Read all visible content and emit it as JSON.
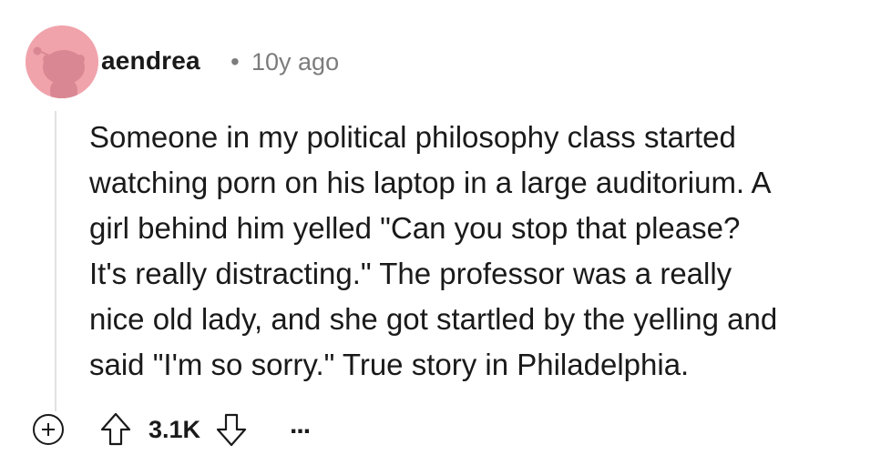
{
  "comment": {
    "username": "aendrea",
    "separator": "•",
    "age": "10y ago",
    "body": "Someone in my political philosophy class started\nwatching porn on his laptop in a large auditorium. A\ngirl behind him yelled \"Can you stop that please?\nIt's really distracting.\" The professor was a really\nnice old lady, and she got startled by the yelling and\nsaid \"I'm so sorry.\" True story in Philadelphia.",
    "score": "3.1K",
    "more_label": "..."
  },
  "icons": {
    "avatar": "snoo-avatar-icon",
    "expand": "plus-circle-icon",
    "upvote": "upvote-arrow-icon",
    "downvote": "downvote-arrow-icon",
    "more": "ellipsis-icon"
  },
  "colors": {
    "avatar_bg": "#f0a3ab",
    "text": "#1a1a1b",
    "meta": "#7c7c7c",
    "thread_line": "#e2e2e2"
  }
}
